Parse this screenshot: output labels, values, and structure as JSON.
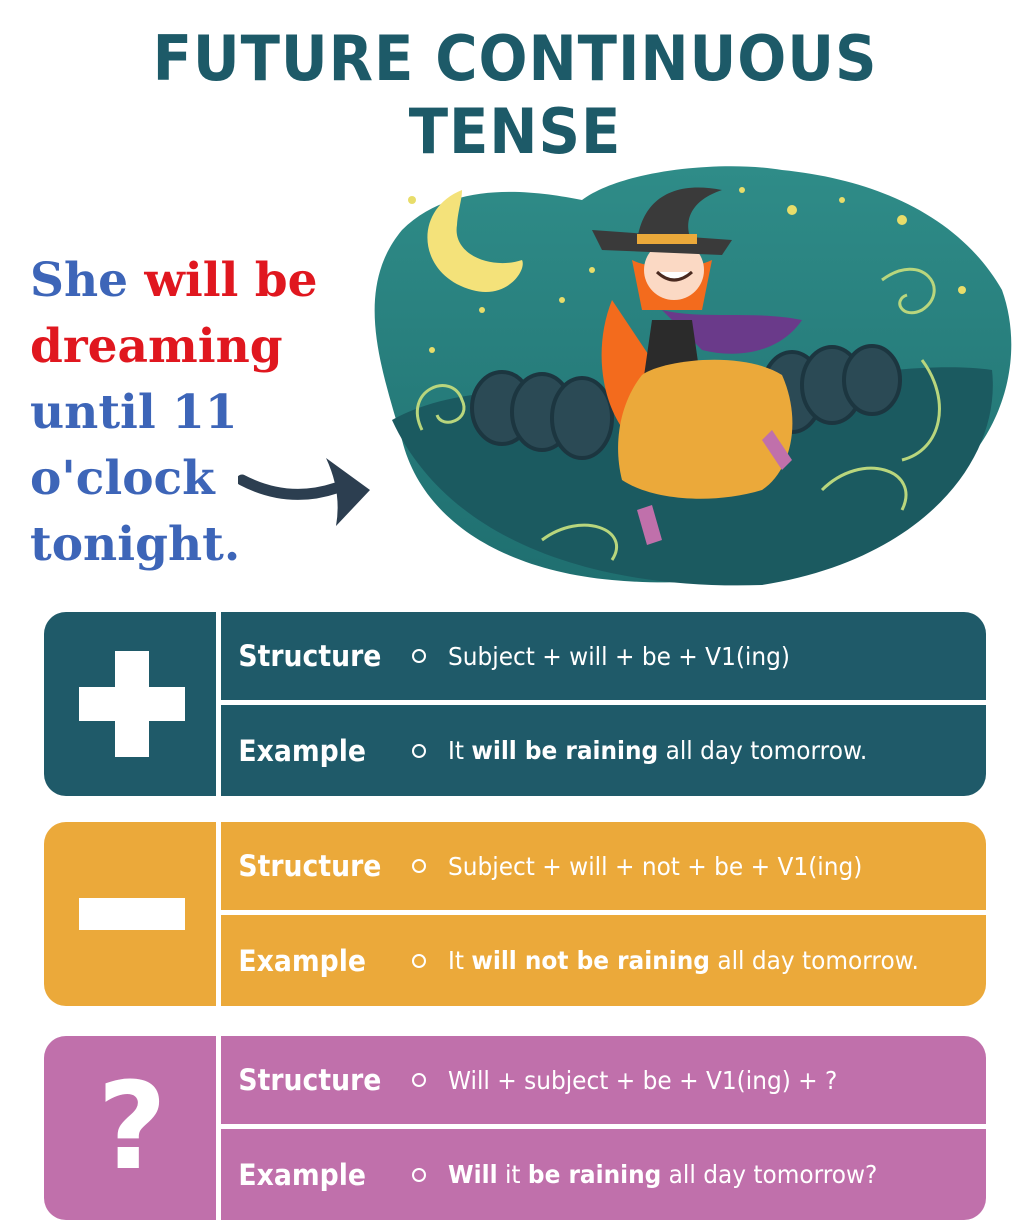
{
  "title": "FUTURE CONTINUOUS TENSE",
  "sentence": {
    "part1": "She ",
    "part2": "will be",
    "part3": "dreaming",
    "part4": "until 11 o'clock",
    "part5": "tonight."
  },
  "colors": {
    "title": "#1d5a68",
    "sentence_blue": "#3d65b8",
    "sentence_red": "#e0171f",
    "positive": "#1f5a69",
    "negative": "#eba93a",
    "question": "#c070ab"
  },
  "icons": {
    "arrow": "right-arrow-icon",
    "positive": "plus-icon",
    "negative": "minus-icon",
    "question": "question-mark-icon"
  },
  "panels": {
    "positive": {
      "structure_label": "Structure",
      "structure": "Subject + will + be + V1(ing)",
      "example_label": "Example",
      "example": {
        "a": "It ",
        "b": "will be raining",
        "c": " all day tomorrow."
      }
    },
    "negative": {
      "structure_label": "Structure",
      "structure": "Subject + will + not + be + V1(ing)",
      "example_label": "Example",
      "example": {
        "a": "It ",
        "b": "will not be raining",
        "c": " all day tomorrow."
      }
    },
    "question": {
      "icon_text": "?",
      "structure_label": "Structure",
      "structure": "Will + subject + be + V1(ing) + ?",
      "example_label": "Example",
      "example": {
        "a": "Will",
        "b": " it ",
        "c": "be raining",
        "d": " all day tomorrow?"
      }
    }
  }
}
